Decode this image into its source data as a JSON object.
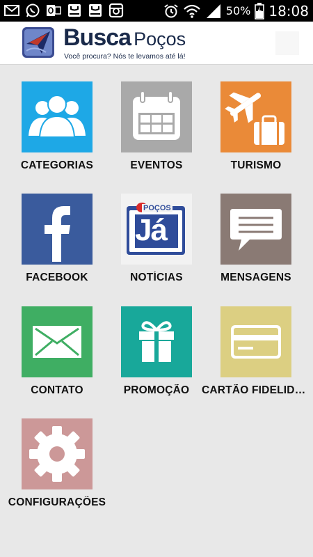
{
  "status_bar": {
    "battery_percent": "50%",
    "time": "18:08",
    "icons": [
      "email-icon",
      "whatsapp-icon",
      "outlook-icon",
      "galaxy-icon",
      "galaxy-icon",
      "instagram-icon",
      "alarm-icon",
      "wifi-icon",
      "signal-icon",
      "battery-icon"
    ]
  },
  "header": {
    "brand_main": "Busca",
    "brand_secondary": "Poços",
    "tagline": "Você procura? Nós te levamos até lá!"
  },
  "grid": {
    "tiles": [
      {
        "label": "CATEGORIAS",
        "icon": "users-icon",
        "color": "#1ea8e6"
      },
      {
        "label": "EVENTOS",
        "icon": "calendar-icon",
        "color": "#a9a9a9"
      },
      {
        "label": "TURISMO",
        "icon": "travel-icon",
        "color": "#ea8a38"
      },
      {
        "label": "FACEBOOK",
        "icon": "facebook-icon",
        "color": "#3a5b9d"
      },
      {
        "label": "NOTÍCIAS",
        "icon": "pocos-ja-logo-icon",
        "color": "#f2f2f2"
      },
      {
        "label": "MENSAGENS",
        "icon": "chat-bubble-icon",
        "color": "#8a7a74"
      },
      {
        "label": "CONTATO",
        "icon": "envelope-icon",
        "color": "#3fae63"
      },
      {
        "label": "PROMOÇÃO",
        "icon": "gift-icon",
        "color": "#18a89a"
      },
      {
        "label": "CARTÃO FIDELIDADE",
        "icon": "credit-card-icon",
        "color": "#dccf82"
      },
      {
        "label": "CONFIGURAÇÕES",
        "icon": "gear-icon",
        "color": "#cc9898"
      }
    ],
    "pocos_ja_logo_text": {
      "top": "POÇOS",
      "main": "Já"
    }
  }
}
